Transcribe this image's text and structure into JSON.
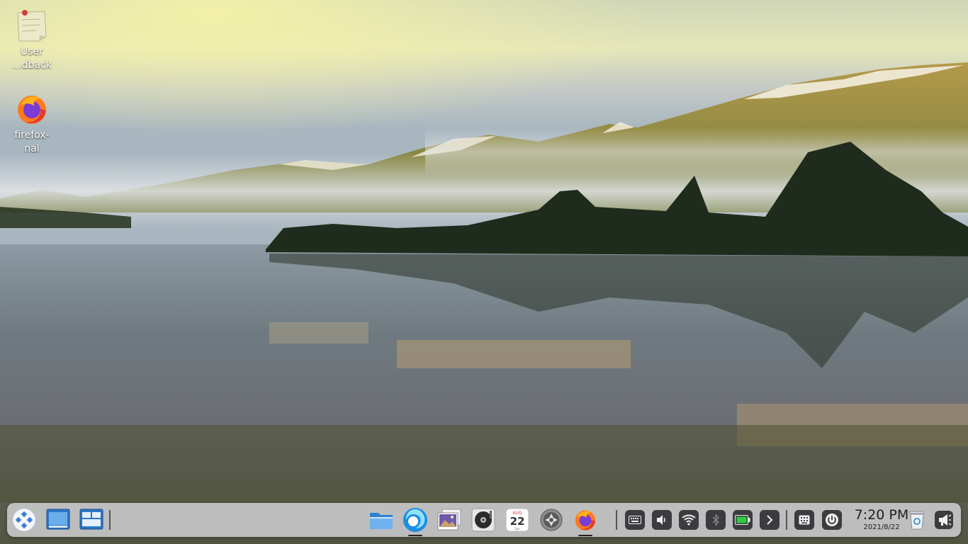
{
  "desktop": {
    "icons": [
      {
        "name": "sticky-note-icon",
        "label_line1": "User",
        "label_line2": "...dback"
      },
      {
        "name": "firefox-icon",
        "label_line1": "firefox-",
        "label_line2": "nal"
      }
    ]
  },
  "dock": {
    "left": [
      "launcher-icon",
      "window-manager-icon",
      "multitask-view-icon"
    ],
    "apps": [
      {
        "name": "file-manager-icon",
        "active": false
      },
      {
        "name": "browser-icon",
        "active": true
      },
      {
        "name": "image-viewer-icon",
        "active": false
      },
      {
        "name": "music-icon",
        "active": false
      },
      {
        "name": "calendar-icon",
        "active": false
      },
      {
        "name": "control-center-icon",
        "active": false
      },
      {
        "name": "firefox-icon",
        "active": true
      }
    ],
    "calendar": {
      "month": "AUG",
      "day": "22",
      "weekday": "Sun"
    },
    "tray": [
      "keyboard-icon",
      "volume-icon",
      "wifi-icon",
      "bluetooth-icon",
      "battery-icon",
      "expand-arrow-icon",
      "onscreen-keyboard-icon",
      "power-icon"
    ],
    "clock": {
      "time": "7:20 PM",
      "date": "2021/8/22"
    },
    "end": [
      "trash-icon",
      "notification-icon"
    ]
  },
  "colors": {
    "dock_bg": "#dadade",
    "tray_button": "#3c3c40",
    "battery_green": "#2ecc40"
  }
}
